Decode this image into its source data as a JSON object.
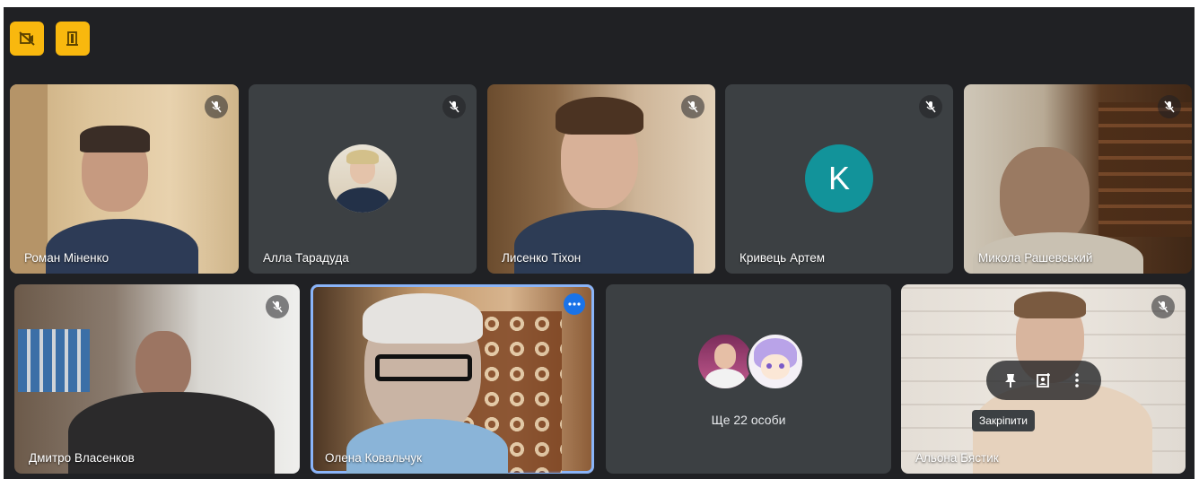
{
  "toolbar": {
    "buttons": [
      {
        "icon": "camera-off-icon",
        "color": "#f9b80e"
      },
      {
        "icon": "door-exit-icon",
        "color": "#f9b80e"
      }
    ]
  },
  "participants": [
    {
      "name": "Роман Міненко",
      "muted": true
    },
    {
      "name": "Алла Тарадуда",
      "muted": true
    },
    {
      "name": "Лисенко Тіхон",
      "muted": true
    },
    {
      "name": "Кривець Артем",
      "muted": true,
      "initial": "K",
      "avatar_color": "#12939a"
    },
    {
      "name": "Микола Рашевський",
      "muted": true
    },
    {
      "name": "Дмитро Власенков",
      "muted": true
    },
    {
      "name": "Олена Ковальчук",
      "muted": false,
      "active": true
    },
    {
      "name": "Альона Бястик",
      "muted": true
    }
  ],
  "overflow_tile": {
    "label": "Ще 22 особи"
  },
  "hover_menu": {
    "pin_tooltip": "Закріпити"
  },
  "colors": {
    "stage_bg": "#202124",
    "tile_bg": "#3c4043",
    "active_border": "#8ab4f8",
    "accent_blue": "#1a73e8"
  }
}
